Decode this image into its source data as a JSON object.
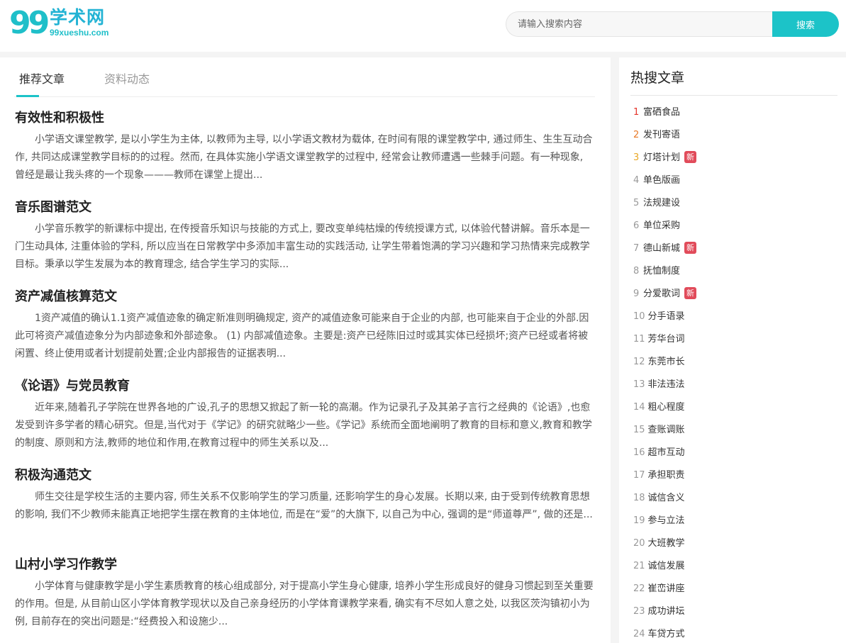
{
  "header": {
    "logo_mark": "99",
    "logo_title": "学术网",
    "logo_domain": "99xueshu.com",
    "search_placeholder": "请输入搜索内容",
    "search_button": "搜索"
  },
  "tabs": [
    {
      "label": "推荐文章",
      "active": true
    },
    {
      "label": "资料动态",
      "active": false
    }
  ],
  "articles": [
    {
      "title": "有效性和积极性",
      "body": "小学语文课堂教学, 是以小学生为主体, 以教师为主导, 以小学语文教材为载体, 在时间有限的课堂教学中, 通过师生、生生互动合作, 共同达成课堂教学目标的的过程。然而, 在具体实施小学语文课堂教学的过程中, 经常会让教师遭遇一些棘手问题。有一种现象, 曾经是最让我头疼的一个现象———教师在课堂上提出..."
    },
    {
      "title": "音乐图谱范文",
      "body": "小学音乐教学的新课标中提出, 在传授音乐知识与技能的方式上, 要改变单纯枯燥的传统授课方式, 以体验代替讲解。音乐本是一门生动具体, 注重体验的学科, 所以应当在日常教学中多添加丰富生动的实践活动, 让学生带着饱满的学习兴趣和学习热情来完成教学目标。秉承以学生发展为本的教育理念, 结合学生学习的实际..."
    },
    {
      "title": "资产减值核算范文",
      "body": "1资产减值的确认1.1资产减值迹象的确定新准则明确规定, 资产的减值迹象可能来自于企业的内部, 也可能来自于企业的外部.因此可将资产减值迹象分为内部迹象和外部迹象。 (1) 内部减值迹象。主要是:资产已经陈旧过时或其实体已经损坏;资产已经或者将被闲置、终止使用或者计划提前处置;企业内部报告的证据表明..."
    },
    {
      "title": "《论语》与党员教育",
      "body": "近年来,随着孔子学院在世界各地的广设,孔子的思想又掀起了新一轮的高潮。作为记录孔子及其弟子言行之经典的《论语》,也愈发受到许多学者的精心研究。但是,当代对于《学记》的研究就略少一些。《学记》系统而全面地阐明了教育的目标和意义,教育和教学的制度、原则和方法,教师的地位和作用,在教育过程中的师生关系以及..."
    },
    {
      "title": "积极沟通范文",
      "body": "师生交往是学校生活的主要内容, 师生关系不仅影响学生的学习质量, 还影响学生的身心发展。长期以来, 由于受到传统教育思想的影响, 我们不少教师未能真正地把学生摆在教育的主体地位, 而是在“爱”的大旗下, 以自己为中心, 强调的是“师道尊严”, 做的还是..."
    },
    {
      "title": "山村小学习作教学",
      "body": "小学体育与健康教学是小学生素质教育的核心组成部分, 对于提高小学生身心健康, 培养小学生形成良好的健身习惯起到至关重要的作用。但是, 从目前山区小学体育教学现状以及自己亲身经历的小学体育课教学来看, 确实有不尽如人意之处, 以我区茨沟镇初小为例, 目前存在的突出问题是:“经费投入和设施少..."
    }
  ],
  "sidebar": {
    "title": "热搜文章",
    "items": [
      {
        "num": "1",
        "label": "富硒食品",
        "badge": ""
      },
      {
        "num": "2",
        "label": "发刊寄语",
        "badge": ""
      },
      {
        "num": "3",
        "label": "灯塔计划",
        "badge": "新"
      },
      {
        "num": "4",
        "label": "单色版画",
        "badge": ""
      },
      {
        "num": "5",
        "label": "法规建设",
        "badge": ""
      },
      {
        "num": "6",
        "label": "单位采购",
        "badge": ""
      },
      {
        "num": "7",
        "label": "德山新城",
        "badge": "新"
      },
      {
        "num": "8",
        "label": "抚恤制度",
        "badge": ""
      },
      {
        "num": "9",
        "label": "分爱歌词",
        "badge": "新"
      },
      {
        "num": "10",
        "label": "分手语录",
        "badge": ""
      },
      {
        "num": "11",
        "label": "芳华台词",
        "badge": ""
      },
      {
        "num": "12",
        "label": "东莞市长",
        "badge": ""
      },
      {
        "num": "13",
        "label": "非法违法",
        "badge": ""
      },
      {
        "num": "14",
        "label": "粗心程度",
        "badge": ""
      },
      {
        "num": "15",
        "label": "查账调账",
        "badge": ""
      },
      {
        "num": "16",
        "label": "超市互动",
        "badge": ""
      },
      {
        "num": "17",
        "label": "承担职责",
        "badge": ""
      },
      {
        "num": "18",
        "label": "诚信含义",
        "badge": ""
      },
      {
        "num": "19",
        "label": "参与立法",
        "badge": ""
      },
      {
        "num": "20",
        "label": "大班教学",
        "badge": ""
      },
      {
        "num": "21",
        "label": "诚信发展",
        "badge": ""
      },
      {
        "num": "22",
        "label": "崔峦讲座",
        "badge": ""
      },
      {
        "num": "23",
        "label": "成功讲坛",
        "badge": ""
      },
      {
        "num": "24",
        "label": "车贷方式",
        "badge": ""
      }
    ]
  },
  "colors": {
    "accent": "#1cc3c8",
    "logo": "#23b3d4",
    "badge": "#e14b5a",
    "rank_1": "#e5352b",
    "rank_2": "#e97a27",
    "rank_3": "#e9a827"
  }
}
